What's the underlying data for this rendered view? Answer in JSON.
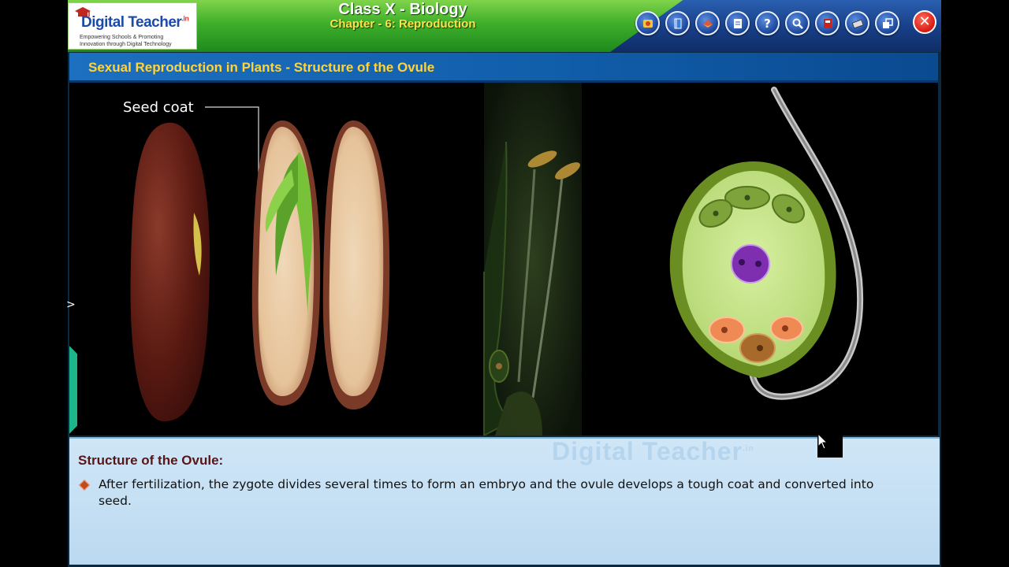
{
  "header": {
    "logo": {
      "brand": "Digital Teacher",
      "brand_suffix": ".in",
      "tagline_1": "Empowering Schools & Promoting",
      "tagline_2": "Innovation through Digital Technology"
    },
    "title": "Class X - Biology",
    "subtitle": "Chapter - 6: Reproduction",
    "toolbar": [
      {
        "icon": "home-icon"
      },
      {
        "icon": "book-icon"
      },
      {
        "icon": "notes-icon"
      },
      {
        "icon": "worksheet-icon"
      },
      {
        "icon": "help-icon",
        "label": "?"
      },
      {
        "icon": "search-icon"
      },
      {
        "icon": "glossary-icon"
      },
      {
        "icon": "tools-icon"
      },
      {
        "icon": "fullscreen-icon"
      }
    ],
    "close_label": "✕"
  },
  "section": {
    "title": "Sexual Reproduction in Plants - Structure of the Ovule"
  },
  "stage": {
    "seed_label": "Seed coat",
    "side_tab_arrow": ">"
  },
  "info": {
    "watermark": "Digital Teacher",
    "watermark_suffix": ".in",
    "heading": "Structure of the Ovule:",
    "bullet_text": "After fertilization, the zygote divides several times to form an embryo and the ovule develops a tough coat and converted into seed."
  },
  "colors": {
    "header_green": "#3fae2a",
    "header_blue": "#173e86",
    "section_bar": "#1260ad",
    "section_title": "#ffd43a",
    "info_panel": "#cfe6f7",
    "heading": "#5a1616"
  }
}
